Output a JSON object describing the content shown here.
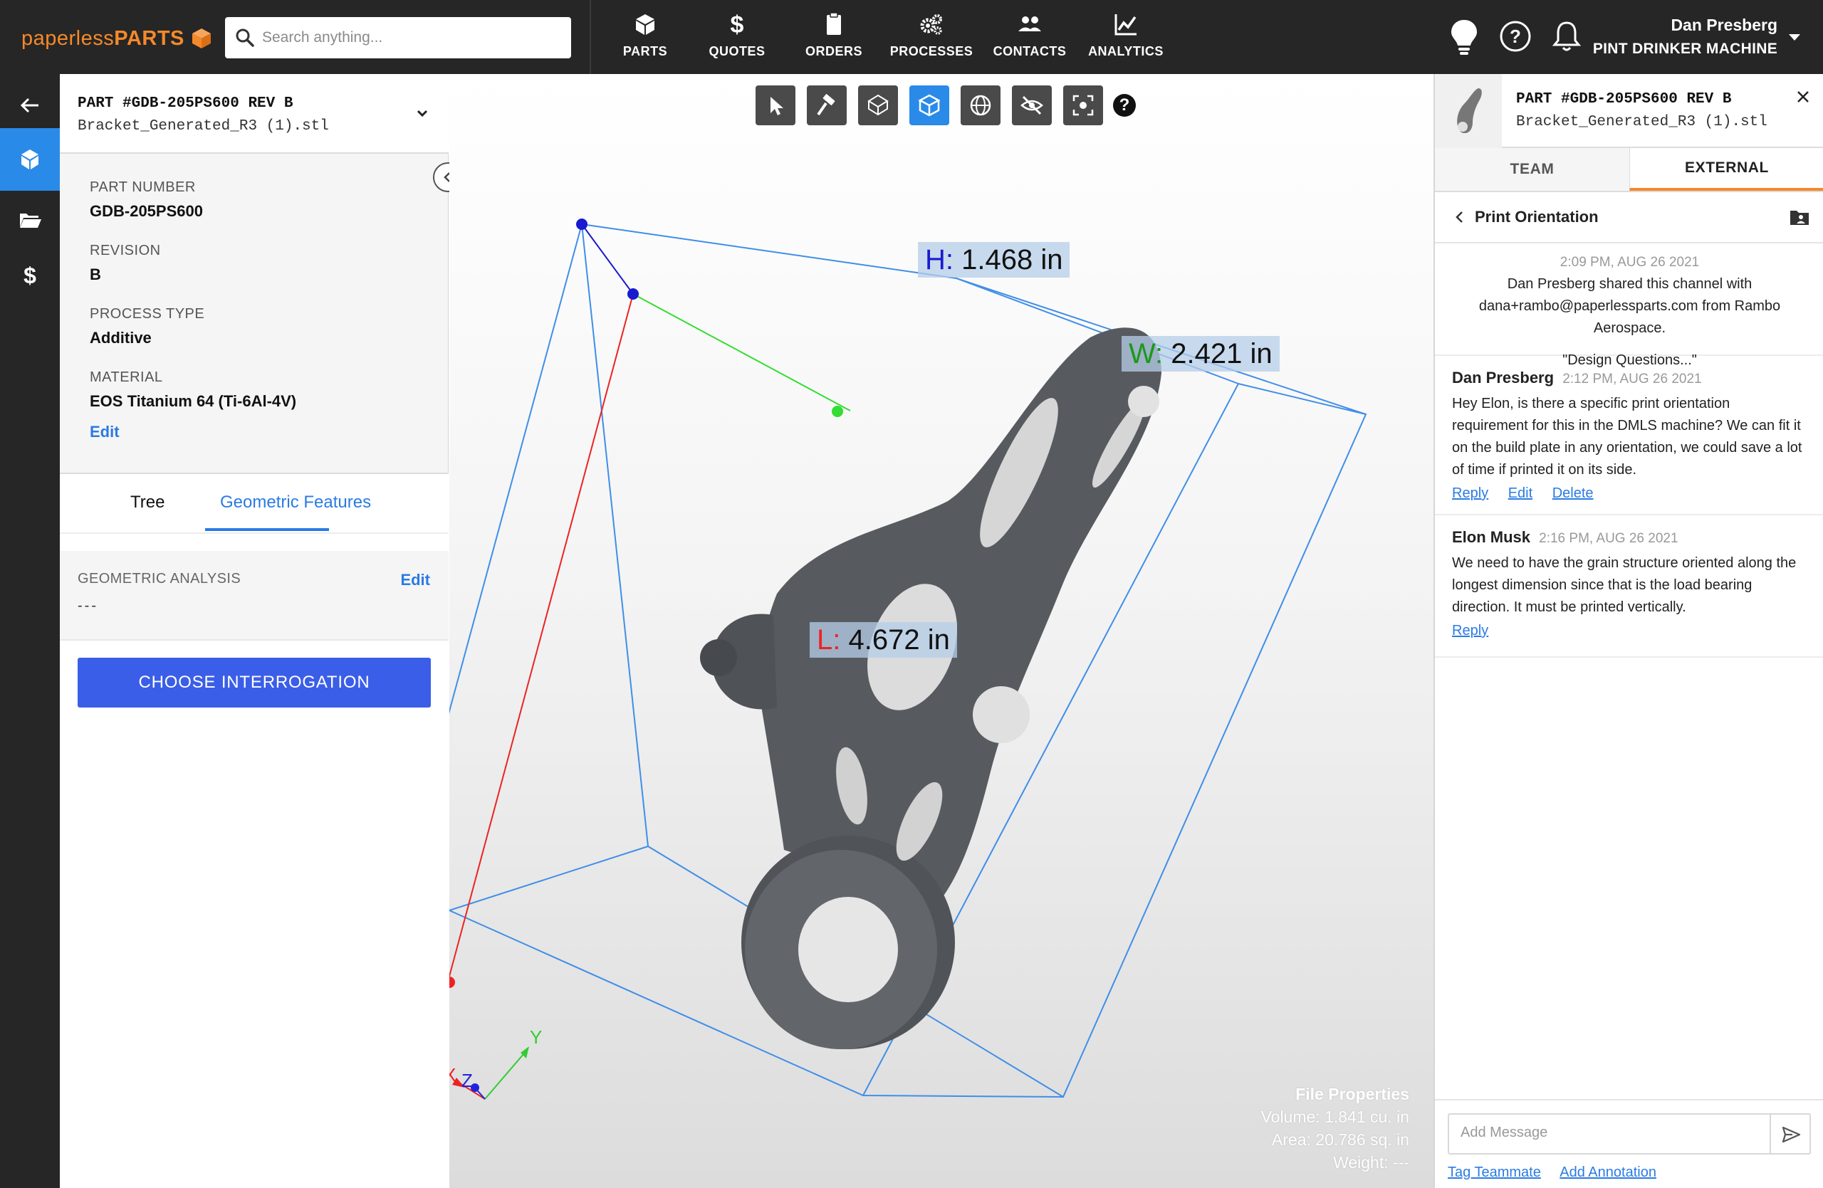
{
  "brand": {
    "part1": "paperless",
    "part2": "PARTS",
    "orange": "#f5892a"
  },
  "search": {
    "placeholder": "Search anything...",
    "value": ""
  },
  "nav": {
    "items": [
      {
        "label": "PARTS",
        "icon": "cube-icon"
      },
      {
        "label": "QUOTES",
        "icon": "dollar-icon"
      },
      {
        "label": "ORDERS",
        "icon": "clipboard-icon"
      },
      {
        "label": "PROCESSES",
        "icon": "gears-icon"
      },
      {
        "label": "CONTACTS",
        "icon": "people-icon"
      },
      {
        "label": "ANALYTICS",
        "icon": "chart-icon"
      }
    ]
  },
  "user": {
    "name": "Dan Presberg",
    "org": "PINT DRINKER MACHINE"
  },
  "rail": {
    "icons": [
      "back-arrow-icon",
      "cube-icon",
      "folder-icon",
      "dollar-icon"
    ],
    "active_color": "#2a8ae8"
  },
  "part": {
    "title": "PART #GDB-205PS600 REV B",
    "file": "Bracket_Generated_R3 (1).stl",
    "fields": [
      {
        "label": "PART NUMBER",
        "value": "GDB-205PS600"
      },
      {
        "label": "REVISION",
        "value": "B"
      },
      {
        "label": "PROCESS TYPE",
        "value": "Additive"
      },
      {
        "label": "MATERIAL",
        "value": "EOS Titanium 64 (Ti-6Al-4V)"
      }
    ],
    "edit_label": "Edit"
  },
  "left_tabs": {
    "tree": "Tree",
    "geometric": "Geometric Features"
  },
  "geometric": {
    "label": "GEOMETRIC ANALYSIS",
    "value": "---",
    "edit": "Edit"
  },
  "choose_button": "CHOOSE INTERROGATION",
  "viewer": {
    "tools": [
      "select-icon",
      "hammer-icon",
      "bounding-box-icon",
      "cube-view-icon",
      "globe-icon",
      "hide-icon",
      "fit-view-icon"
    ],
    "active_tool": "cube-view-icon",
    "help": "?",
    "dimensions": {
      "h_prefix": "H:",
      "h_value": "1.468 in",
      "w_prefix": "W:",
      "w_value": "2.421 in",
      "l_prefix": "L:",
      "l_value": "4.672 in"
    },
    "axes": {
      "x": "X",
      "y": "Y",
      "z": "Z"
    },
    "file_properties": {
      "title": "File Properties",
      "volume": "Volume: 1.841 cu. in",
      "area": "Area: 20.786 sq. in",
      "weight": "Weight: ---"
    }
  },
  "chat": {
    "part_title": "PART #GDB-205PS600 REV B",
    "part_file": "Bracket_Generated_R3 (1).stl",
    "tabs": {
      "team": "TEAM",
      "external": "EXTERNAL"
    },
    "channel": "Print Orientation",
    "system": {
      "time": "2:09 PM, AUG 26 2021",
      "text": "Dan Presberg shared this channel with dana+rambo@paperlessparts.com from Rambo Aerospace.",
      "quote": "\"Design Questions...\""
    },
    "messages": [
      {
        "author": "Dan Presberg",
        "time": "2:12 PM, AUG 26 2021",
        "text": "Hey Elon, is there a specific print orientation requirement for this in the DMLS machine? We can fit it on the build plate in any orientation, we could save a lot of time if printed it on its side.",
        "actions": [
          "Reply",
          "Edit",
          "Delete"
        ]
      },
      {
        "author": "Elon Musk",
        "time": "2:16 PM, AUG 26 2021",
        "text": "We need to have the grain structure oriented along the longest dimension since that is the load bearing direction. It must be printed vertically.",
        "actions": [
          "Reply"
        ]
      }
    ],
    "composer": {
      "placeholder": "Add Message",
      "tag": "Tag Teammate",
      "annotate": "Add Annotation"
    }
  }
}
